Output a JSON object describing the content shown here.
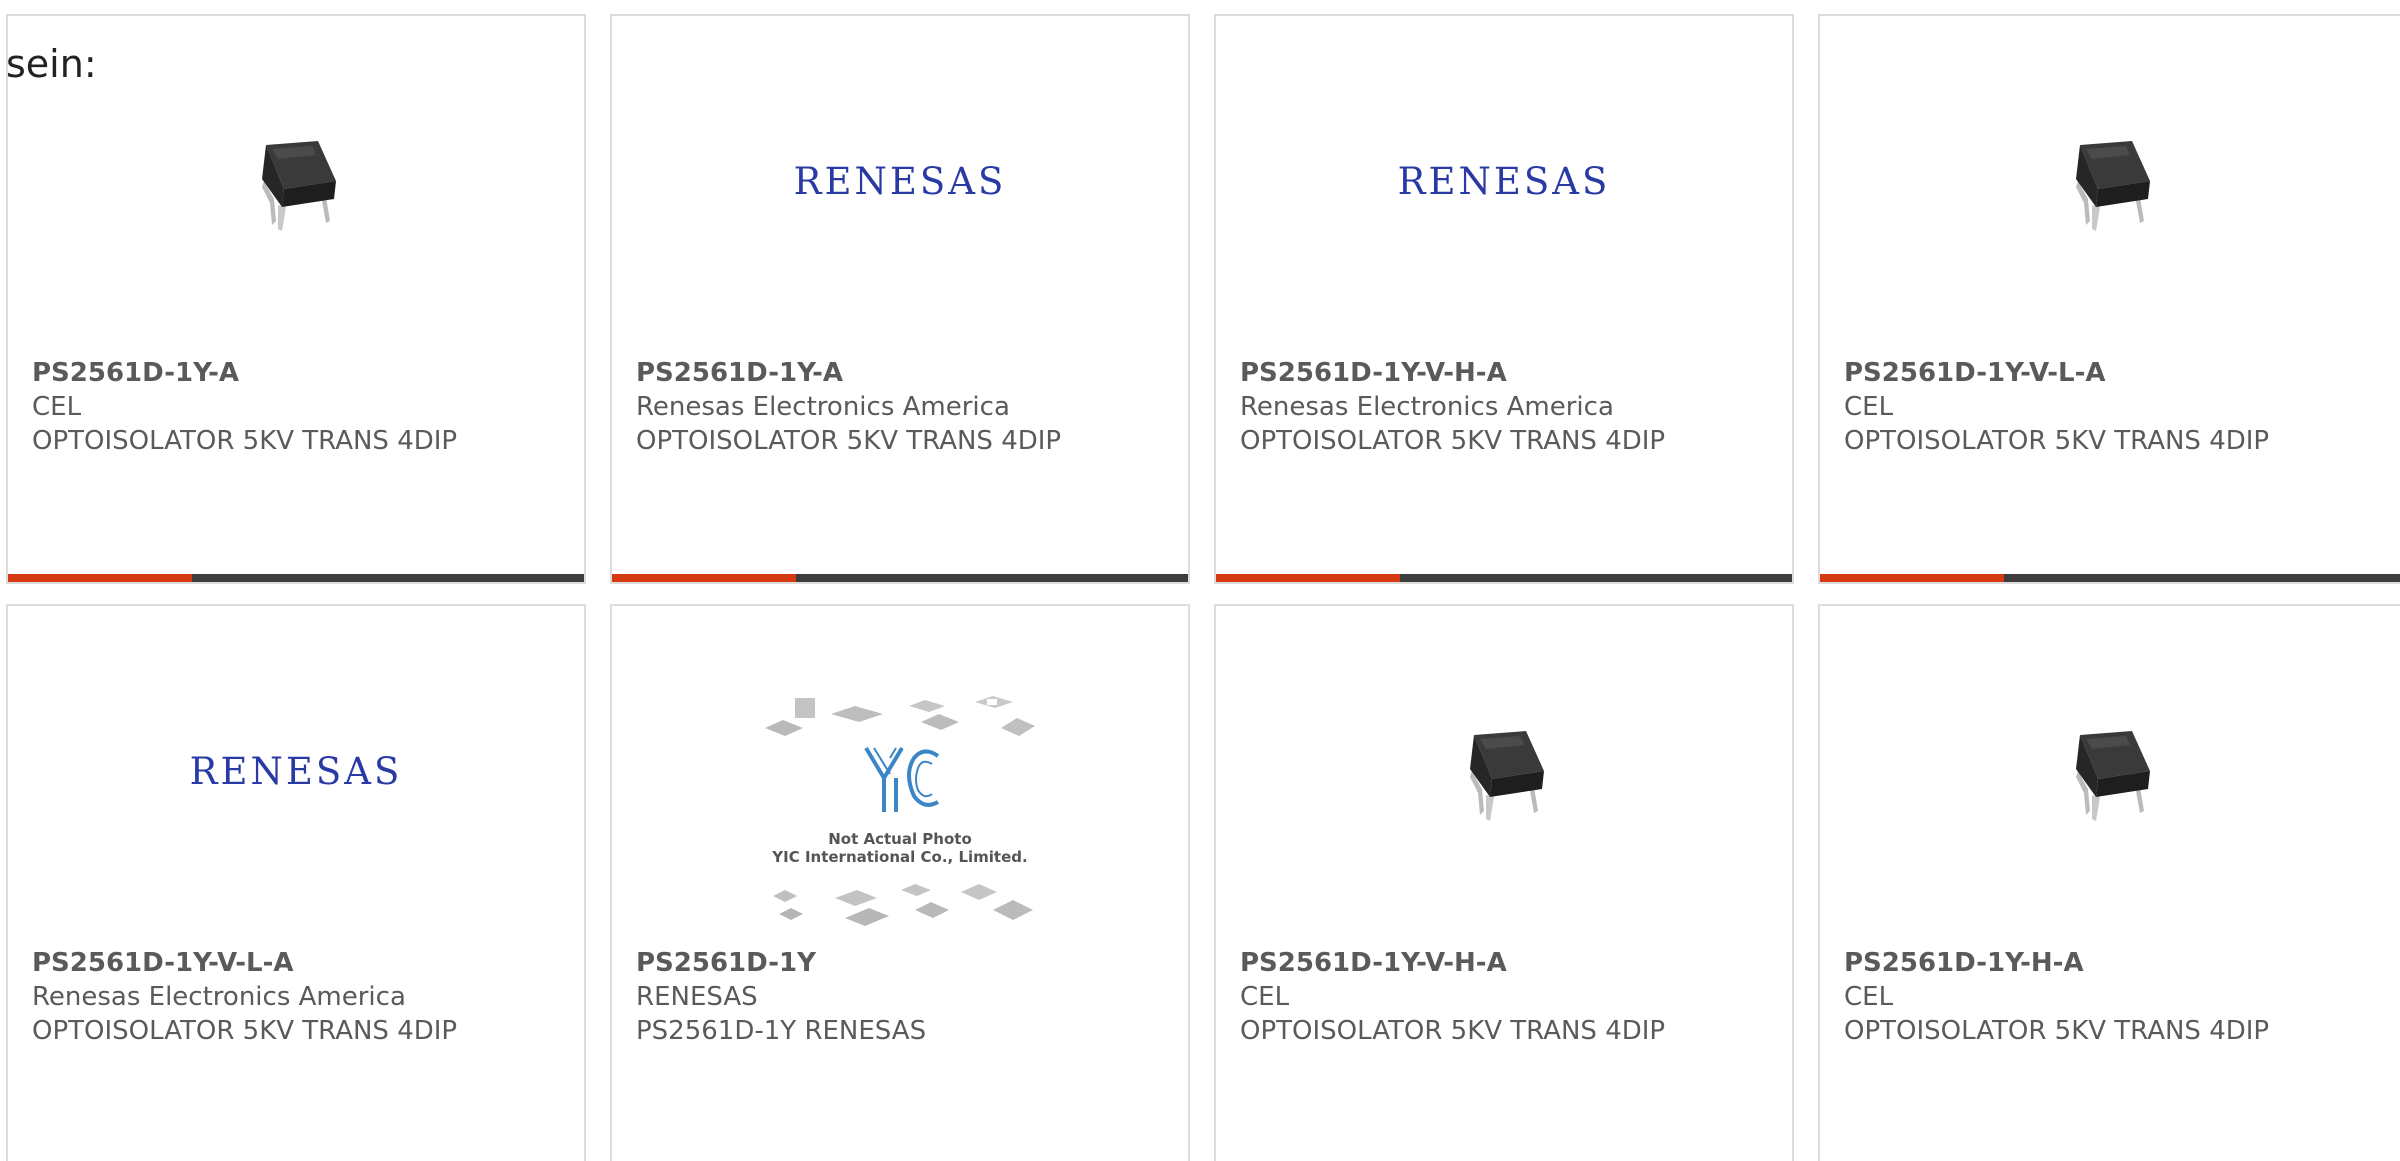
{
  "intro_text": "sein:",
  "brand_colors": {
    "accent": "#d63a12",
    "bar_dark": "#3d3d3d",
    "text": "#5a5a5a",
    "renesas_blue": "#2a3aa5"
  },
  "accent_fraction": 0.32,
  "cards": [
    {
      "part_number": "PS2561D-1Y-A",
      "manufacturer": "CEL",
      "description": "OPTOISOLATOR 5KV TRANS 4DIP",
      "image": "optocoupler-photo"
    },
    {
      "part_number": "PS2561D-1Y-A",
      "manufacturer": "Renesas Electronics America",
      "description": "OPTOISOLATOR 5KV TRANS 4DIP",
      "image": "renesas-logo"
    },
    {
      "part_number": "PS2561D-1Y-V-H-A",
      "manufacturer": "Renesas Electronics America",
      "description": "OPTOISOLATOR 5KV TRANS 4DIP",
      "image": "renesas-logo"
    },
    {
      "part_number": "PS2561D-1Y-V-L-A",
      "manufacturer": "CEL",
      "description": "OPTOISOLATOR 5KV TRANS 4DIP",
      "image": "optocoupler-photo"
    },
    {
      "part_number": "PS2561D-1Y-V-L-A",
      "manufacturer": "Renesas Electronics America",
      "description": "OPTOISOLATOR 5KV TRANS 4DIP",
      "image": "renesas-logo"
    },
    {
      "part_number": "PS2561D-1Y",
      "manufacturer": "RENESAS",
      "description": "PS2561D-1Y RENESAS",
      "image": "yic-placeholder"
    },
    {
      "part_number": "PS2561D-1Y-V-H-A",
      "manufacturer": "CEL",
      "description": "OPTOISOLATOR 5KV TRANS 4DIP",
      "image": "optocoupler-photo"
    },
    {
      "part_number": "PS2561D-1Y-H-A",
      "manufacturer": "CEL",
      "description": "OPTOISOLATOR 5KV TRANS 4DIP",
      "image": "optocoupler-photo"
    }
  ],
  "renesas_logo_text": "RENESAS",
  "yic_placeholder": {
    "logo": "YIC",
    "line1": "Not Actual Photo",
    "line2": "YIC International Co., Limited."
  }
}
